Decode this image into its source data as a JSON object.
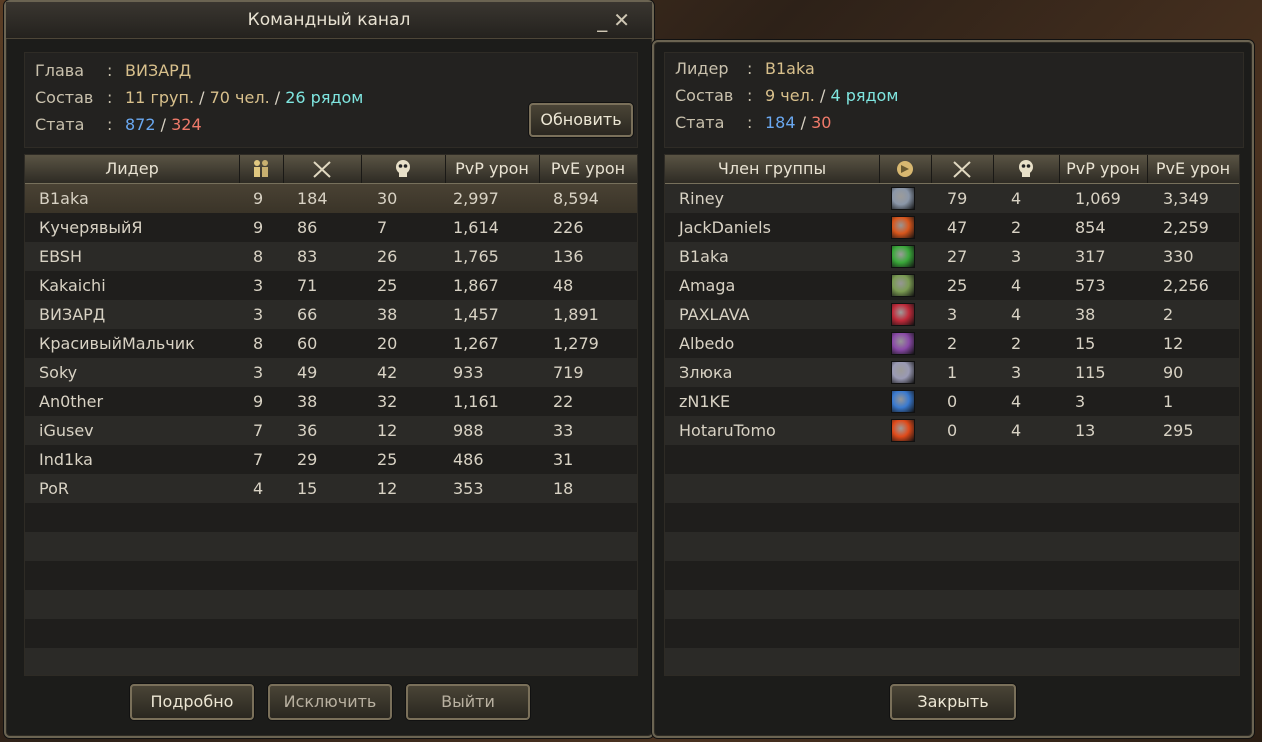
{
  "command_channel": {
    "title": "Командный канал",
    "minimize_icon": "minimize-icon",
    "close_icon": "close-icon",
    "info": {
      "head_label": "Глава",
      "head_value": "ВИЗАРД",
      "composition_label": "Состав",
      "groups": "11 груп.",
      "members": "70 чел.",
      "nearby": "26 рядом",
      "stats_label": "Стата",
      "kills": "872",
      "deaths": "324",
      "colon": ":",
      "slash": " / "
    },
    "refresh_button": "Обновить",
    "columns": {
      "leader": "Лидер",
      "members_icon": "people-icon",
      "kills_icon": "crossed-swords-icon",
      "deaths_icon": "skull-icon",
      "pvp": "PvP урон",
      "pve": "PvE урон"
    },
    "rows": [
      {
        "name": "B1aka",
        "count": "9",
        "kills": "184",
        "deaths": "30",
        "pvp": "2,997",
        "pve": "8,594"
      },
      {
        "name": "КучерявыйЯ",
        "count": "9",
        "kills": "86",
        "deaths": "7",
        "pvp": "1,614",
        "pve": "226"
      },
      {
        "name": "EBSH",
        "count": "8",
        "kills": "83",
        "deaths": "26",
        "pvp": "1,765",
        "pve": "136"
      },
      {
        "name": "Kakaichi",
        "count": "3",
        "kills": "71",
        "deaths": "25",
        "pvp": "1,867",
        "pve": "48"
      },
      {
        "name": "ВИЗАРД",
        "count": "3",
        "kills": "66",
        "deaths": "38",
        "pvp": "1,457",
        "pve": "1,891"
      },
      {
        "name": "КрасивыйМальчик",
        "count": "8",
        "kills": "60",
        "deaths": "20",
        "pvp": "1,267",
        "pve": "1,279"
      },
      {
        "name": "Soky",
        "count": "3",
        "kills": "49",
        "deaths": "42",
        "pvp": "933",
        "pve": "719"
      },
      {
        "name": "An0ther",
        "count": "9",
        "kills": "38",
        "deaths": "32",
        "pvp": "1,161",
        "pve": "22"
      },
      {
        "name": "iGusev",
        "count": "7",
        "kills": "36",
        "deaths": "12",
        "pvp": "988",
        "pve": "33"
      },
      {
        "name": "Ind1ka",
        "count": "7",
        "kills": "29",
        "deaths": "25",
        "pvp": "486",
        "pve": "31"
      },
      {
        "name": "PoR",
        "count": "4",
        "kills": "15",
        "deaths": "12",
        "pvp": "353",
        "pve": "18"
      }
    ],
    "buttons": {
      "details": "Подробно",
      "kick": "Исключить",
      "leave": "Выйти"
    }
  },
  "group_panel": {
    "info": {
      "leader_label": "Лидер",
      "leader_value": "B1aka",
      "composition_label": "Состав",
      "members": "9 чел.",
      "nearby": "4 рядом",
      "stats_label": "Стата",
      "kills": "184",
      "deaths": "30",
      "colon": ":",
      "slash": " / "
    },
    "columns": {
      "member": "Член группы",
      "class_icon": "class-emblem-icon",
      "kills_icon": "crossed-swords-icon",
      "deaths_icon": "skull-icon",
      "pvp": "PvP урон",
      "pve": "PvE урон"
    },
    "rows": [
      {
        "name": "Riney",
        "icon": "class-icon-silver",
        "icon_color": "#8a96a8",
        "kills": "79",
        "deaths": "4",
        "pvp": "1,069",
        "pve": "3,349"
      },
      {
        "name": "JackDaniels",
        "icon": "class-icon-fire",
        "icon_color": "#d8561c",
        "kills": "47",
        "deaths": "2",
        "pvp": "854",
        "pve": "2,259"
      },
      {
        "name": "B1aka",
        "icon": "class-icon-leaf",
        "icon_color": "#3aa83a",
        "kills": "27",
        "deaths": "3",
        "pvp": "317",
        "pve": "330"
      },
      {
        "name": "Amaga",
        "icon": "class-icon-beast",
        "icon_color": "#7a9a52",
        "kills": "25",
        "deaths": "4",
        "pvp": "573",
        "pve": "2,256"
      },
      {
        "name": "PAXLAVA",
        "icon": "class-icon-blade",
        "icon_color": "#c02a3a",
        "kills": "3",
        "deaths": "4",
        "pvp": "38",
        "pve": "2"
      },
      {
        "name": "Albedo",
        "icon": "class-icon-shadow",
        "icon_color": "#8a4aa8",
        "kills": "2",
        "deaths": "2",
        "pvp": "15",
        "pve": "12"
      },
      {
        "name": "Злюка",
        "icon": "class-icon-spirit",
        "icon_color": "#9a9ab4",
        "kills": "1",
        "deaths": "3",
        "pvp": "115",
        "pve": "90"
      },
      {
        "name": "zN1KE",
        "icon": "class-icon-water",
        "icon_color": "#3a7ad0",
        "kills": "0",
        "deaths": "4",
        "pvp": "3",
        "pve": "1"
      },
      {
        "name": "HotaruTomo",
        "icon": "class-icon-flame",
        "icon_color": "#e04a1a",
        "kills": "0",
        "deaths": "4",
        "pvp": "13",
        "pve": "295"
      }
    ],
    "close_button": "Закрыть"
  }
}
